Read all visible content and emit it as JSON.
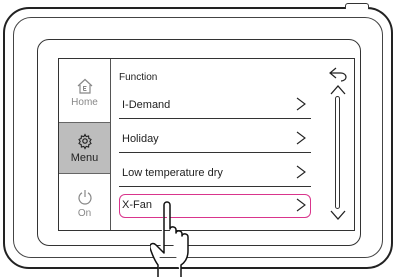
{
  "nav": {
    "home_label": "Home",
    "menu_label": "Menu",
    "on_label": "On"
  },
  "main": {
    "title": "Function",
    "items": [
      {
        "label": "I-Demand"
      },
      {
        "label": "Holiday"
      },
      {
        "label": "Low temperature dry"
      },
      {
        "label": "X-Fan"
      }
    ]
  },
  "colors": {
    "highlight": "#d9358c",
    "selected_nav_bg": "#bdbdbd"
  },
  "icons": [
    "home-icon",
    "gear-icon",
    "power-icon",
    "chevron-right-icon",
    "back-arrow-icon",
    "scroll-up-icon",
    "scroll-down-icon",
    "hand-pointer-icon"
  ]
}
